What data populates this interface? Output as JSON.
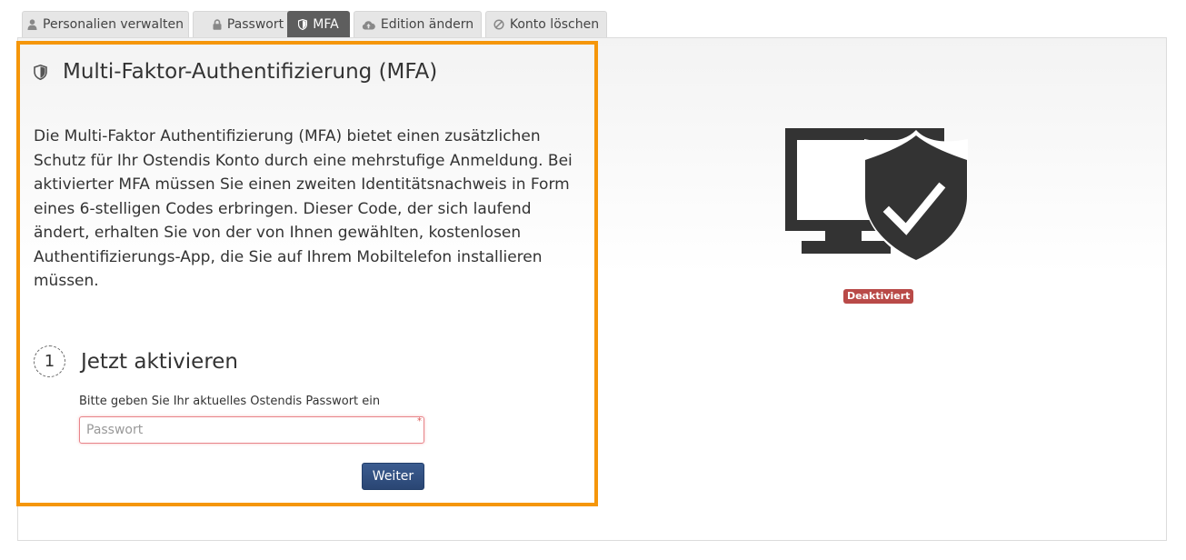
{
  "tabs": [
    {
      "label": "Personalien verwalten",
      "icon": "user-icon",
      "active": false
    },
    {
      "label": "Passwort",
      "icon": "lock-icon",
      "active": false
    },
    {
      "label": "MFA",
      "icon": "shield-icon",
      "active": true
    },
    {
      "label": "Edition ändern",
      "icon": "cloud-upload-icon",
      "active": false
    },
    {
      "label": "Konto löschen",
      "icon": "ban-icon",
      "active": false
    }
  ],
  "main": {
    "title": "Multi-Faktor-Authentifizierung (MFA)",
    "description": "Die Multi-Faktor Authentifizierung (MFA) bietet einen zusätzlichen Schutz für Ihr Ostendis Konto durch eine mehrstufige Anmeldung. Bei aktivierter MFA müssen Sie einen zweiten Identitätsnachweis in Form eines 6-stelligen Codes erbringen. Dieser Code, der sich laufend ändert, erhalten Sie von der von Ihnen gewählten, kostenlosen Authentifizierungs-App, die Sie auf Ihrem Mobiltelefon installieren müssen.",
    "step": {
      "number": "1",
      "title": "Jetzt aktivieren",
      "password_label": "Bitte geben Sie Ihr aktuelles Ostendis Passwort ein",
      "password_placeholder": "Passwort",
      "password_value": "",
      "required_marker": "*",
      "submit_label": "Weiter"
    }
  },
  "status": {
    "label": "Deaktiviert",
    "color": "#b94a48",
    "icon": "monitor-shield-check-icon"
  },
  "colors": {
    "highlight_border": "#f5960a",
    "active_tab": "#5e5e5e",
    "primary_button": "#2f4f80"
  }
}
